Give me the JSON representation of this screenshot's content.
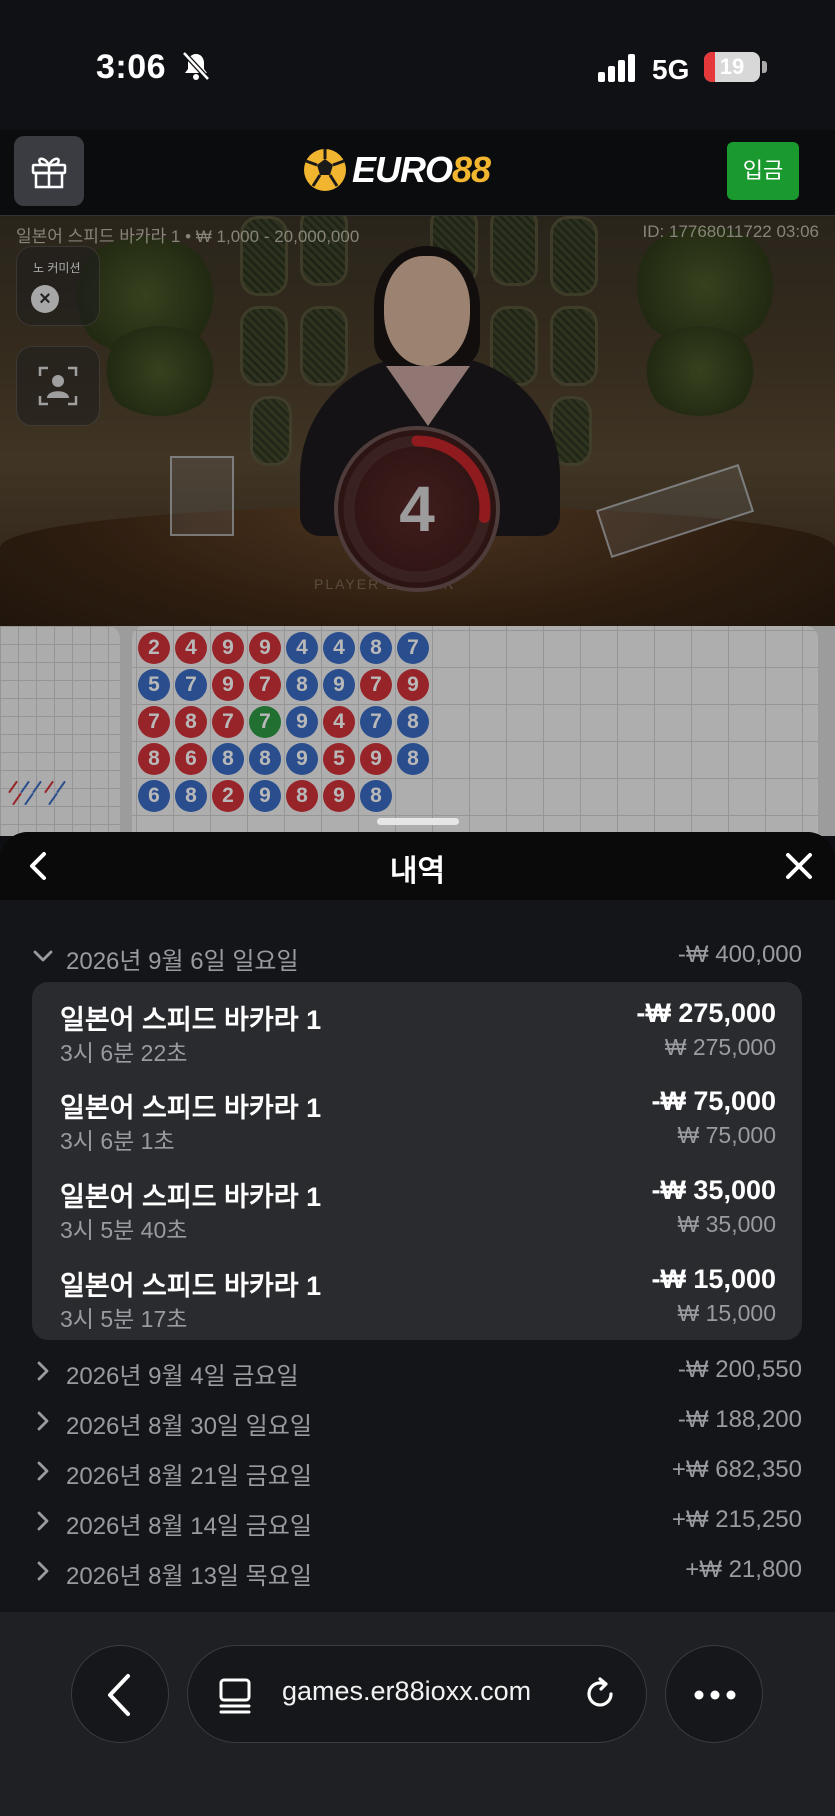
{
  "status_bar": {
    "time": "3:06",
    "network": "5G",
    "battery": "19",
    "battery_level": 0.19
  },
  "header": {
    "logo_euro": "EURO",
    "logo_num": "88",
    "deposit_label": "입금"
  },
  "video": {
    "table_info": "일본어 스피드 바카라 1 • ₩ 1,000 - 20,000,000",
    "round_id": "ID: 17768011722 03:06",
    "commission_label": "노 커미션",
    "countdown": "4",
    "countdown_progress": 0.27,
    "table_label": "PLAYER    BANKER"
  },
  "bead_road": {
    "columns": [
      [
        [
          "2",
          "B"
        ],
        [
          "5",
          "P"
        ],
        [
          "7",
          "B"
        ],
        [
          "8",
          "B"
        ],
        [
          "6",
          "P"
        ]
      ],
      [
        [
          "4",
          "B"
        ],
        [
          "7",
          "P"
        ],
        [
          "8",
          "B"
        ],
        [
          "6",
          "B"
        ],
        [
          "8",
          "P"
        ]
      ],
      [
        [
          "9",
          "B"
        ],
        [
          "9",
          "B"
        ],
        [
          "7",
          "B"
        ],
        [
          "8",
          "P"
        ],
        [
          "2",
          "B"
        ]
      ],
      [
        [
          "9",
          "B"
        ],
        [
          "7",
          "B"
        ],
        [
          "7",
          "T"
        ],
        [
          "8",
          "P"
        ],
        [
          "9",
          "P"
        ]
      ],
      [
        [
          "4",
          "P"
        ],
        [
          "8",
          "P"
        ],
        [
          "9",
          "P"
        ],
        [
          "9",
          "P"
        ],
        [
          "8",
          "B"
        ]
      ],
      [
        [
          "4",
          "P"
        ],
        [
          "9",
          "P"
        ],
        [
          "4",
          "B"
        ],
        [
          "5",
          "B"
        ],
        [
          "9",
          "B"
        ]
      ],
      [
        [
          "8",
          "P"
        ],
        [
          "7",
          "B"
        ],
        [
          "7",
          "P"
        ],
        [
          "9",
          "B"
        ],
        [
          "8",
          "P"
        ]
      ],
      [
        [
          "7",
          "P"
        ],
        [
          "9",
          "B"
        ],
        [
          "8",
          "P"
        ],
        [
          "8",
          "P"
        ],
        null
      ]
    ]
  },
  "history": {
    "title": "내역",
    "expanded_day": {
      "label": "2026년 9월 6일 일요일",
      "amount": "-₩ 400,000"
    },
    "bets": [
      {
        "game": "일본어 스피드 바카라 1",
        "time": "3시 6분 22초",
        "result": "-₩ 275,000",
        "stake": "₩ 275,000"
      },
      {
        "game": "일본어 스피드 바카라 1",
        "time": "3시 6분 1초",
        "result": "-₩ 75,000",
        "stake": "₩ 75,000"
      },
      {
        "game": "일본어 스피드 바카라 1",
        "time": "3시 5분 40초",
        "result": "-₩ 35,000",
        "stake": "₩ 35,000"
      },
      {
        "game": "일본어 스피드 바카라 1",
        "time": "3시 5분 17초",
        "result": "-₩ 15,000",
        "stake": "₩ 15,000"
      }
    ],
    "days": [
      {
        "label": "2026년 9월 4일 금요일",
        "amount": "-₩ 200,550"
      },
      {
        "label": "2026년 8월 30일 일요일",
        "amount": "-₩ 188,200"
      },
      {
        "label": "2026년 8월 21일 금요일",
        "amount": "+₩ 682,350"
      },
      {
        "label": "2026년 8월 14일 금요일",
        "amount": "+₩ 215,250"
      },
      {
        "label": "2026년 8월 13일 목요일",
        "amount": "+₩ 21,800"
      }
    ]
  },
  "browser": {
    "url": "games.er88ioxx.com"
  }
}
